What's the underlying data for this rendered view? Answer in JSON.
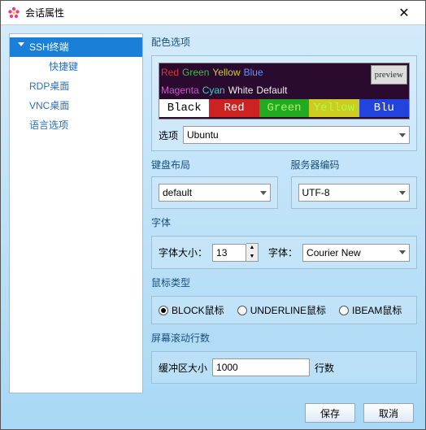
{
  "window": {
    "title": "会话属性"
  },
  "sidebar": {
    "items": [
      {
        "label": "SSH终端",
        "selected": true,
        "hasArrow": true
      },
      {
        "label": "快捷键",
        "child": true
      },
      {
        "label": "RDP桌面"
      },
      {
        "label": "VNC桌面"
      },
      {
        "label": "语言选项"
      }
    ]
  },
  "sections": {
    "color": {
      "label": "配色选项",
      "option_label": "选项",
      "option_value": "Ubuntu",
      "preview_label": "preview",
      "row1": [
        {
          "t": "Red",
          "c": "#d33"
        },
        {
          "t": "Green",
          "c": "#4b4"
        },
        {
          "t": "Yellow",
          "c": "#cc3"
        },
        {
          "t": "Blue",
          "c": "#59f"
        }
      ],
      "row2": [
        {
          "t": "Magenta",
          "c": "#c5c"
        },
        {
          "t": "Cyan",
          "c": "#4cc"
        },
        {
          "t": "White",
          "c": "#eee"
        },
        {
          "t": "Default",
          "c": "#eee"
        }
      ],
      "bar": [
        {
          "t": "Black",
          "bg": "#fff",
          "fg": "#000"
        },
        {
          "t": "Red",
          "bg": "#c22",
          "fg": "#fff"
        },
        {
          "t": "Green",
          "bg": "#2a2",
          "fg": "#ae6"
        },
        {
          "t": "Yellow",
          "bg": "#cc2",
          "fg": "#af4"
        },
        {
          "t": "Blu",
          "bg": "#24d",
          "fg": "#fff"
        }
      ]
    },
    "keyboard": {
      "label": "键盘布局",
      "value": "default"
    },
    "encoding": {
      "label": "服务器编码",
      "value": "UTF-8"
    },
    "font": {
      "label": "字体",
      "size_label": "字体大小：",
      "size_value": "13",
      "family_label": "字体：",
      "family_value": "Courier New"
    },
    "mouse": {
      "label": "鼠标类型",
      "options": [
        "BLOCK鼠标",
        "UNDERLINE鼠标",
        "IBEAM鼠标"
      ],
      "selected": 0
    },
    "scroll": {
      "label": "屏幕滚动行数",
      "buffer_label": "缓冲区大小",
      "buffer_value": "1000",
      "unit": "行数"
    }
  },
  "buttons": {
    "save": "保存",
    "cancel": "取消"
  }
}
